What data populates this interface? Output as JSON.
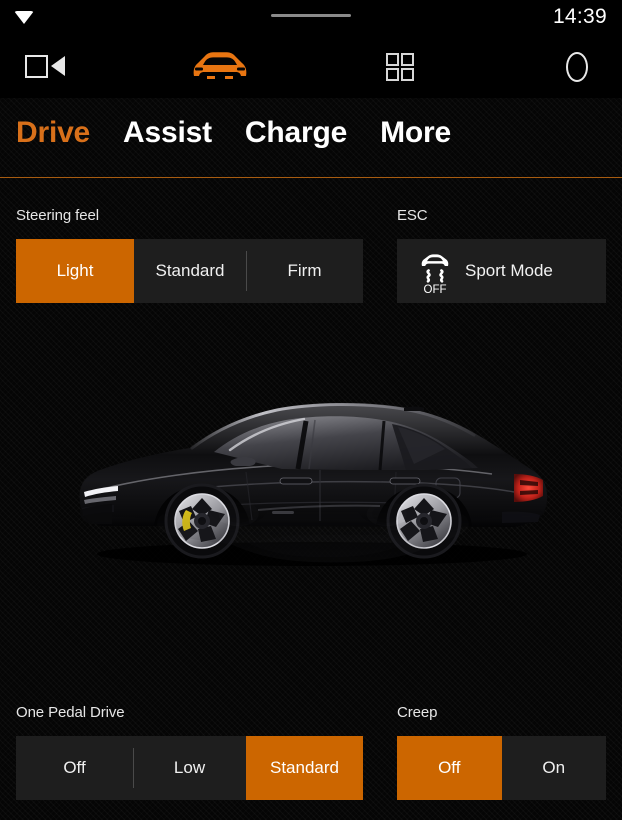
{
  "status_bar": {
    "wifi_icon": "wifi-icon",
    "drag_handle": "drag-handle",
    "time": "14:39"
  },
  "nav_bar": {
    "items": [
      {
        "name": "media-icon",
        "label": "Media"
      },
      {
        "name": "car-icon",
        "label": "Car"
      },
      {
        "name": "apps-icon",
        "label": "Apps"
      },
      {
        "name": "profile-icon",
        "label": "Profile"
      }
    ]
  },
  "tabs": [
    {
      "label": "Drive",
      "active": true
    },
    {
      "label": "Assist",
      "active": false
    },
    {
      "label": "Charge",
      "active": false
    },
    {
      "label": "More",
      "active": false
    }
  ],
  "sections": {
    "steering_feel": {
      "label": "Steering feel",
      "options": [
        {
          "label": "Light",
          "selected": true
        },
        {
          "label": "Standard",
          "selected": false
        },
        {
          "label": "Firm",
          "selected": false
        }
      ]
    },
    "esc": {
      "label": "ESC",
      "tile_label": "Sport Mode",
      "icon_name": "esc-off-icon",
      "icon_text": "OFF"
    },
    "one_pedal_drive": {
      "label": "One Pedal Drive",
      "options": [
        {
          "label": "Off",
          "selected": false
        },
        {
          "label": "Low",
          "selected": false
        },
        {
          "label": "Standard",
          "selected": true
        }
      ]
    },
    "creep": {
      "label": "Creep",
      "options": [
        {
          "label": "Off",
          "selected": true
        },
        {
          "label": "On",
          "selected": false
        }
      ]
    }
  },
  "car_illustration": {
    "name": "vehicle-side-view",
    "description": "Black electric fastback sedan, side profile, with floor reflection"
  },
  "colors": {
    "accent_orange": "#cc6600",
    "tab_active": "#d8701a",
    "tab_underline": "#a85c10",
    "tile_background": "#1e1e1e",
    "screen_background": "#050505",
    "text_primary": "#ffffff",
    "divider": "#4a4a4a"
  }
}
